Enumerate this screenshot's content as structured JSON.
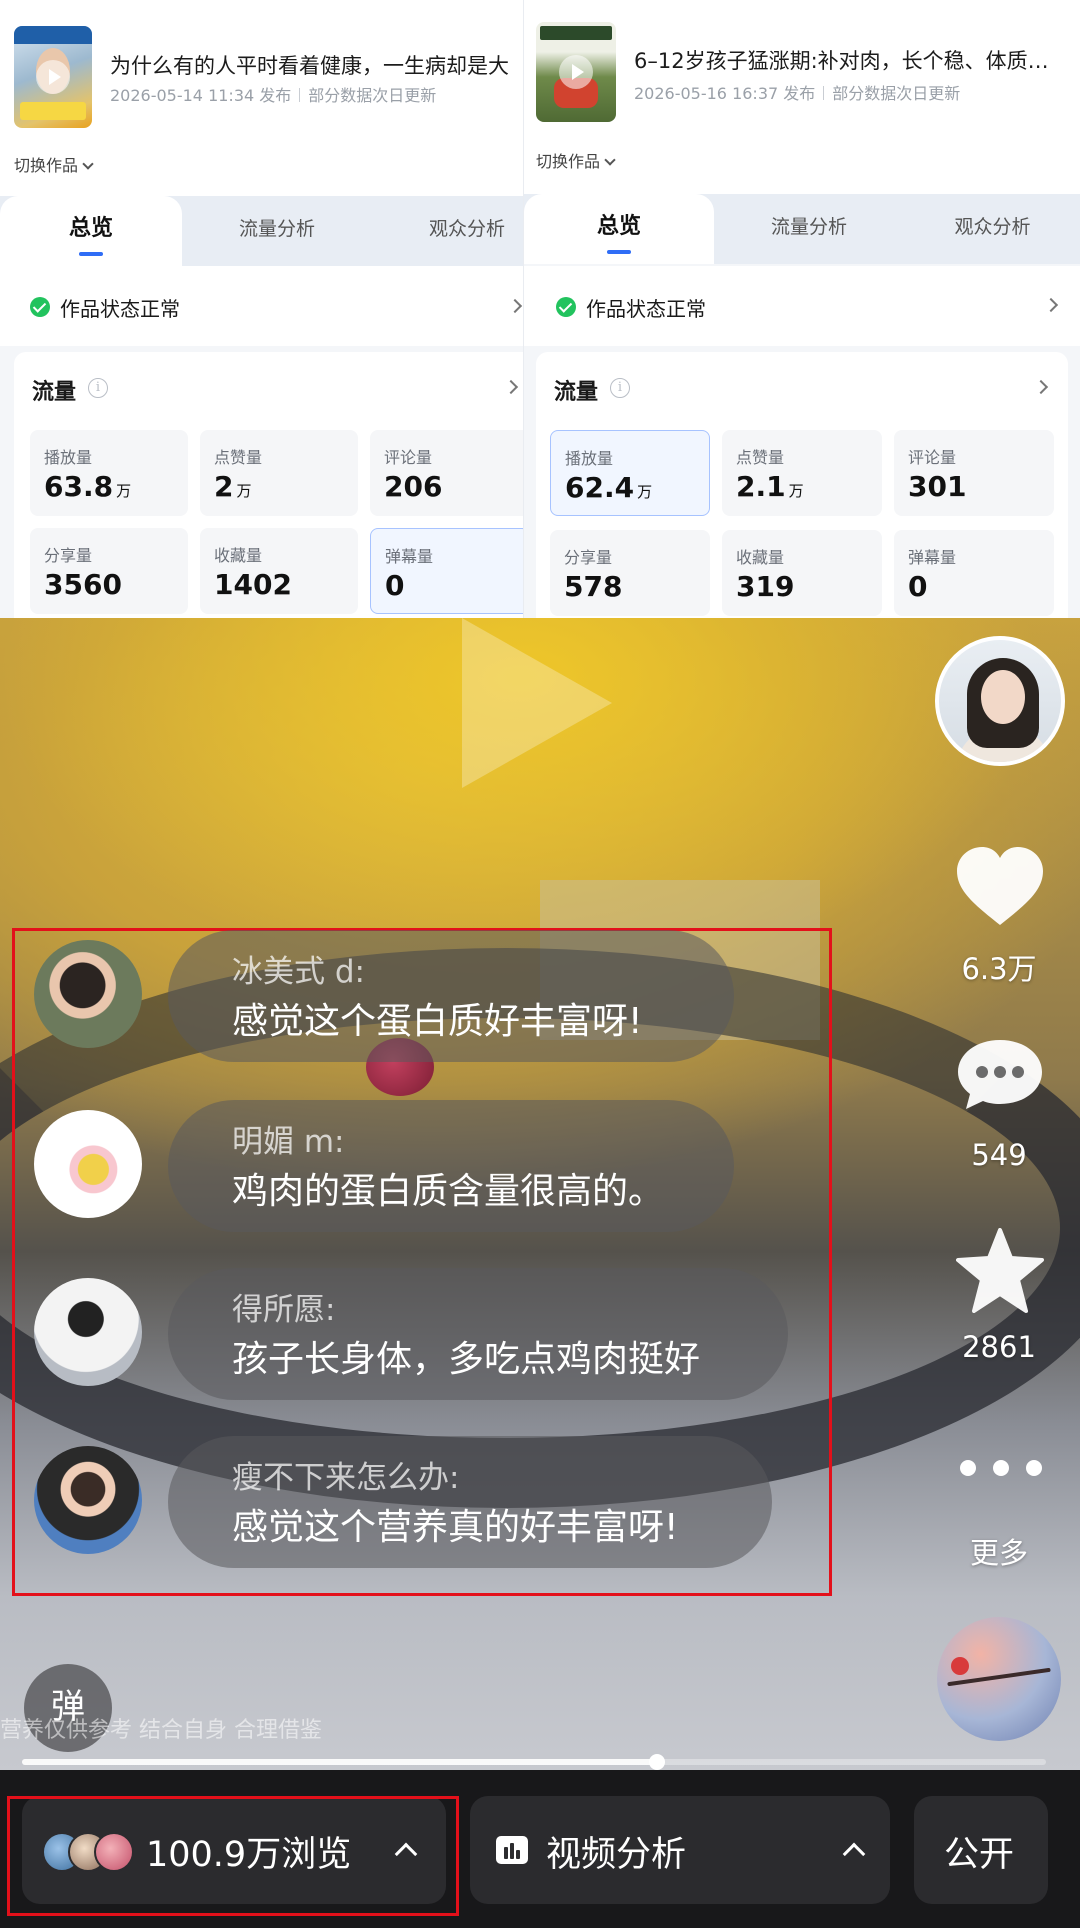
{
  "left_panel": {
    "video_title": "为什么有的人平时看着健康，一生病却是大",
    "publish_time": "2026-05-14 11:34 发布",
    "update_note": "部分数据次日更新",
    "switch_label": "切换作品",
    "tabs": [
      "总览",
      "流量分析",
      "观众分析"
    ],
    "status_text": "作品状态正常",
    "section_title": "流量",
    "metrics": [
      {
        "label": "播放量",
        "value": "63.8",
        "unit": "万"
      },
      {
        "label": "点赞量",
        "value": "2",
        "unit": "万"
      },
      {
        "label": "评论量",
        "value": "206",
        "unit": ""
      },
      {
        "label": "分享量",
        "value": "3560",
        "unit": ""
      },
      {
        "label": "收藏量",
        "value": "1402",
        "unit": ""
      },
      {
        "label": "弹幕量",
        "value": "0",
        "unit": ""
      }
    ]
  },
  "right_panel": {
    "video_title": "6–12岁孩子猛涨期:补对肉，长个稳、体质…",
    "publish_time": "2026-05-16 16:37 发布",
    "update_note": "部分数据次日更新",
    "switch_label": "切换作品",
    "tabs": [
      "总览",
      "流量分析",
      "观众分析"
    ],
    "status_text": "作品状态正常",
    "section_title": "流量",
    "metrics": [
      {
        "label": "播放量",
        "value": "62.4",
        "unit": "万"
      },
      {
        "label": "点赞量",
        "value": "2.1",
        "unit": "万"
      },
      {
        "label": "评论量",
        "value": "301",
        "unit": ""
      },
      {
        "label": "分享量",
        "value": "578",
        "unit": ""
      },
      {
        "label": "收藏量",
        "value": "319",
        "unit": ""
      },
      {
        "label": "弹幕量",
        "value": "0",
        "unit": ""
      }
    ]
  },
  "video": {
    "likes": "6.3万",
    "comments_count": "549",
    "favorites": "2861",
    "more_label": "更多",
    "danmaku_button": "弹",
    "caption": "营养仅供参考 结合自身 合理借鉴",
    "progress": 0.62,
    "comments": [
      {
        "name": "冰美式 d:",
        "text": "感觉这个蛋白质好丰富呀!"
      },
      {
        "name": "明媚 m:",
        "text": "鸡肉的蛋白质含量很高的。"
      },
      {
        "name": "得所愿:",
        "text": "孩子长身体，多吃点鸡肉挺好"
      },
      {
        "name": "瘦不下来怎么办:",
        "text": "感觉这个营养真的好丰富呀!"
      }
    ]
  },
  "bottom_bar": {
    "views_label": "100.9万浏览",
    "analysis_label": "视频分析",
    "public_label": "公开"
  },
  "colors": {
    "accent_blue": "#2f6df6",
    "status_green": "#22c35e",
    "highlight_red": "#e3101a"
  }
}
